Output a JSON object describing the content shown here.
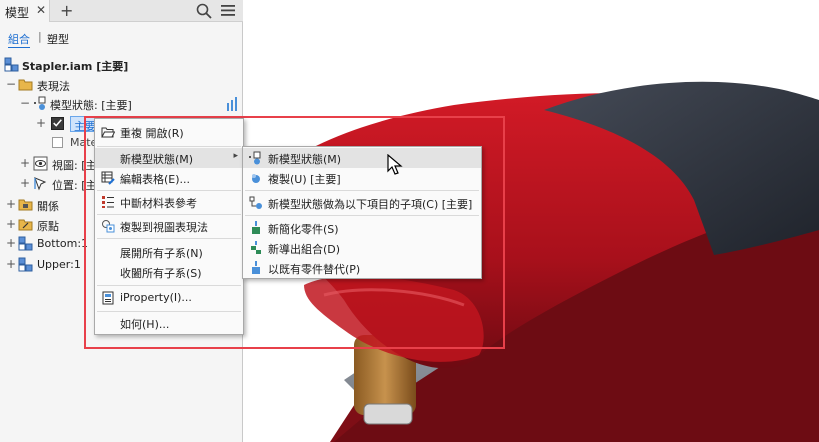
{
  "tabs": {
    "active_label": "模型",
    "close_glyph": "✕",
    "add_glyph": "+"
  },
  "view_toggle": {
    "assembly": "組合",
    "separator": "|",
    "modeling": "塑型"
  },
  "tree": {
    "root": "Stapler.iam [主要]",
    "representations": "表現法",
    "model_state": "模型狀態: [主要]",
    "main_item": "主要",
    "material_item": "Mate",
    "view_item": "視圖: [主",
    "position_item": "位置: [主",
    "relationships": "關係",
    "origin": "原點",
    "bottom": "Bottom:1",
    "upper": "Upper:1"
  },
  "context_menu": {
    "items": [
      "重複 開啟(R)",
      "新模型狀態(M)",
      "編輯表格(E)...",
      "中斷材料表參考",
      "複製到視圖表現法",
      "展開所有子系(N)",
      "收闔所有子系(S)",
      "iProperty(I)...",
      "如何(H)..."
    ],
    "submenu_arrow": "▸"
  },
  "submenu": {
    "items": [
      "新模型狀態(M)",
      "複製(U) [主要]",
      "新模型狀態做為以下項目的子項(C) [主要]",
      "新簡化零件(S)",
      "新導出組合(D)",
      "以既有零件替代(P)"
    ]
  },
  "colors": {
    "accent_blue": "#1e6fd1",
    "highlight_red": "#e8404a",
    "stapler_red": "#b3121d",
    "stapler_dark": "#2b2f38",
    "folder_yellow": "#e8b64a"
  }
}
